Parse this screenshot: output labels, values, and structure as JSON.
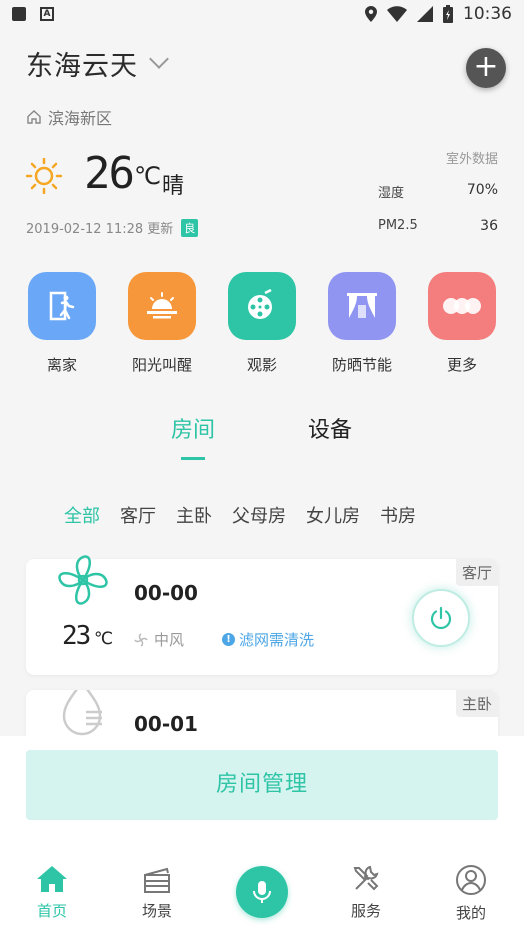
{
  "status_bar": {
    "time": "10:36",
    "icons": [
      "notification-icon",
      "a-icon",
      "location-icon",
      "wifi-icon",
      "signal-icon",
      "battery-icon"
    ]
  },
  "header": {
    "home_name": "东海云天",
    "location": "滨海新区"
  },
  "weather": {
    "temperature": "26",
    "unit": "℃",
    "condition": "晴",
    "updated": "2019-02-12 11:28 更新",
    "quality_badge": "良",
    "outdoor_title": "室外数据",
    "humidity_label": "湿度",
    "humidity_value": "70%",
    "pm25_label": "PM2.5",
    "pm25_value": "36"
  },
  "scenes": [
    {
      "label": "离家",
      "icon": "leave-home-icon",
      "color": "#6aa8f7"
    },
    {
      "label": "阳光叫醒",
      "icon": "sunrise-icon",
      "color": "#f5973a"
    },
    {
      "label": "观影",
      "icon": "film-reel-icon",
      "color": "#2ec4a6"
    },
    {
      "label": "防晒节能",
      "icon": "curtain-icon",
      "color": "#8f95f0"
    },
    {
      "label": "更多",
      "icon": "more-icon",
      "color": "#f47d7d"
    }
  ],
  "tabs": {
    "rooms": "房间",
    "devices": "设备"
  },
  "filters": [
    "全部",
    "客厅",
    "主卧",
    "父母房",
    "女儿房",
    "书房"
  ],
  "devices": [
    {
      "name": "00-00",
      "room": "客厅",
      "temperature": "23",
      "unit": "℃",
      "wind": "中风",
      "warning": "滤网需清洗",
      "icon": "fan-icon"
    },
    {
      "name": "00-01",
      "room": "主卧",
      "icon": "humidifier-drop-icon"
    }
  ],
  "room_manage_label": "房间管理",
  "accent_color": "#2ec4a6",
  "nav": {
    "home": "首页",
    "scenes": "场景",
    "service": "服务",
    "mine": "我的"
  }
}
